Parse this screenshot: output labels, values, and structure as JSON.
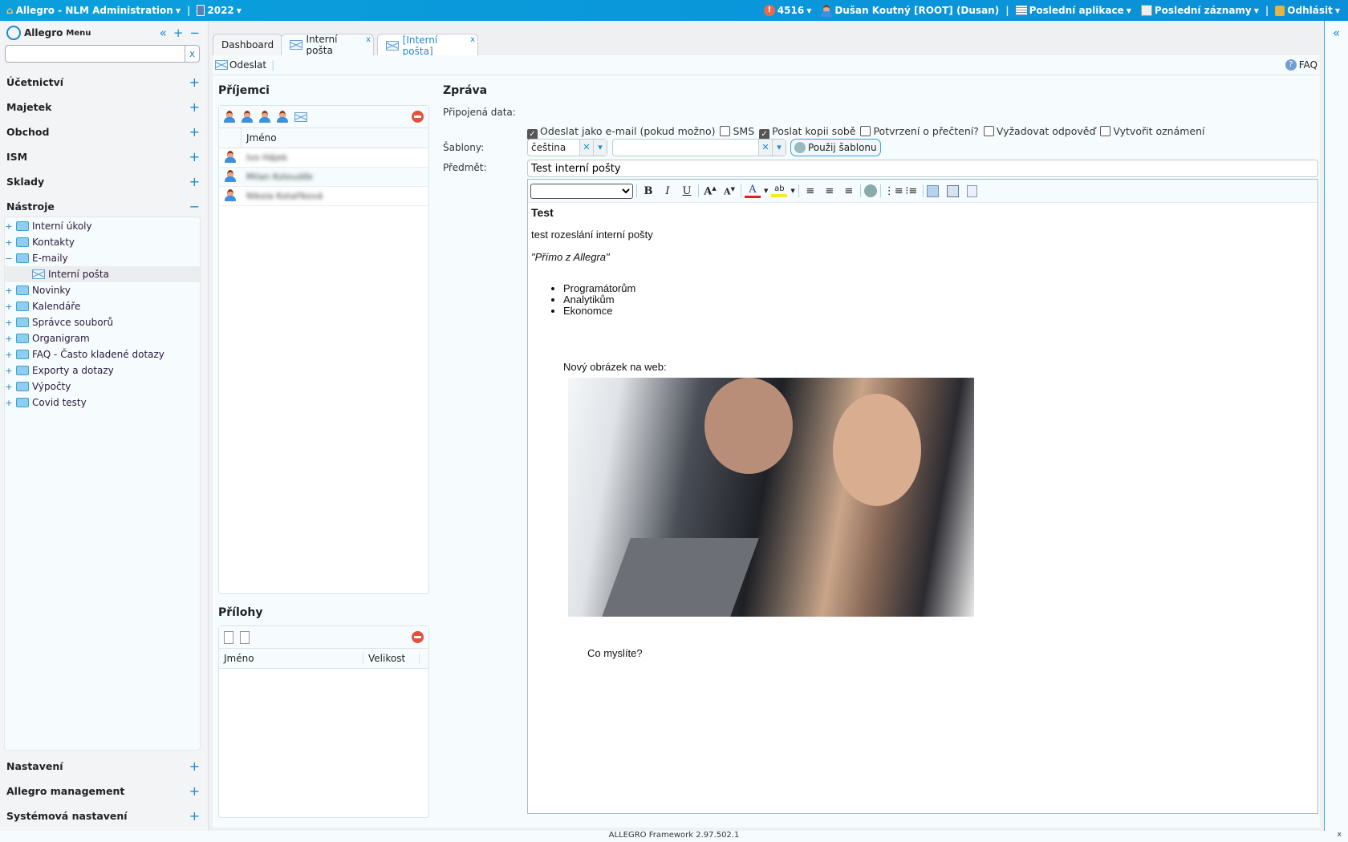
{
  "topbar": {
    "app_title": "Allegro - NLM Administration",
    "year": "2022",
    "alerts": "4516",
    "user": "Dušan Koutný [ROOT] (Dusan)",
    "recent_apps": "Poslední aplikace",
    "recent_records": "Poslední záznamy",
    "logout": "Odhlásit"
  },
  "sidebar": {
    "logo": "Allegro",
    "menu_label": "Menu",
    "search_value": "",
    "search_clear": "x",
    "sections_top": [
      {
        "label": "Účetnictví",
        "toggle": "+"
      },
      {
        "label": "Majetek",
        "toggle": "+"
      },
      {
        "label": "Obchod",
        "toggle": "+"
      },
      {
        "label": "ISM",
        "toggle": "+"
      },
      {
        "label": "Sklady",
        "toggle": "+"
      },
      {
        "label": "Nástroje",
        "toggle": "−"
      }
    ],
    "tree": [
      {
        "label": "Interní úkoly",
        "exp": "+"
      },
      {
        "label": "Kontakty",
        "exp": "+"
      },
      {
        "label": "E-maily",
        "exp": "−"
      },
      {
        "label": "Interní pošta",
        "exp": ""
      },
      {
        "label": "Novinky",
        "exp": "+"
      },
      {
        "label": "Kalendáře",
        "exp": "+"
      },
      {
        "label": "Správce souborů",
        "exp": "+"
      },
      {
        "label": "Organigram",
        "exp": "+"
      },
      {
        "label": "FAQ - Často kladené dotazy",
        "exp": "+"
      },
      {
        "label": "Exporty a dotazy",
        "exp": "+"
      },
      {
        "label": "Výpočty",
        "exp": "+"
      },
      {
        "label": "Covid testy",
        "exp": "+"
      }
    ],
    "sections_bottom": [
      {
        "label": "Nastavení",
        "toggle": "+"
      },
      {
        "label": "Allegro management",
        "toggle": "+"
      },
      {
        "label": "Systémová nastavení",
        "toggle": "+"
      }
    ]
  },
  "tabs": [
    {
      "label": "Dashboard"
    },
    {
      "label": "Interní pošta",
      "close": "x"
    },
    {
      "label": "[Interní pošta]",
      "close": "x"
    }
  ],
  "toolbar": {
    "send": "Odeslat",
    "faq": "FAQ"
  },
  "recipients": {
    "title": "Příjemci",
    "col_name": "Jméno",
    "rows": [
      "Ivo Hájek",
      "Milan Kolouděk",
      "Nikola Kotaříková"
    ]
  },
  "attachments": {
    "title": "Přílohy",
    "col_name": "Jméno",
    "col_size": "Velikost"
  },
  "message": {
    "title": "Zpráva",
    "attached_label": "Připojená data:",
    "options": [
      {
        "label": "Odeslat jako e-mail (pokud možno)",
        "checked": true
      },
      {
        "label": "SMS",
        "checked": false
      },
      {
        "label": "Poslat kopii sobě",
        "checked": true
      },
      {
        "label": "Potvrzení o přečtení?",
        "checked": false
      },
      {
        "label": "Vyžadovat odpověď",
        "checked": false
      },
      {
        "label": "Vytvořit oznámení",
        "checked": false
      }
    ],
    "templates_label": "Šablony:",
    "template_lang": "čeština",
    "template_value": "",
    "apply_template": "Použij šablonu",
    "subject_label": "Předmět:",
    "subject": "Test interní pošty",
    "body": {
      "heading": "Test",
      "line1": "test rozeslání interní pošty",
      "quote": "\"Přímo z Allegra\"",
      "list": [
        "Programátorům",
        "Analytikům",
        "Ekonomce"
      ],
      "image_caption": "Nový obrázek na web:",
      "closing": "Co myslíte?"
    }
  },
  "footer": "ALLEGRO Framework 2.97.502.1"
}
